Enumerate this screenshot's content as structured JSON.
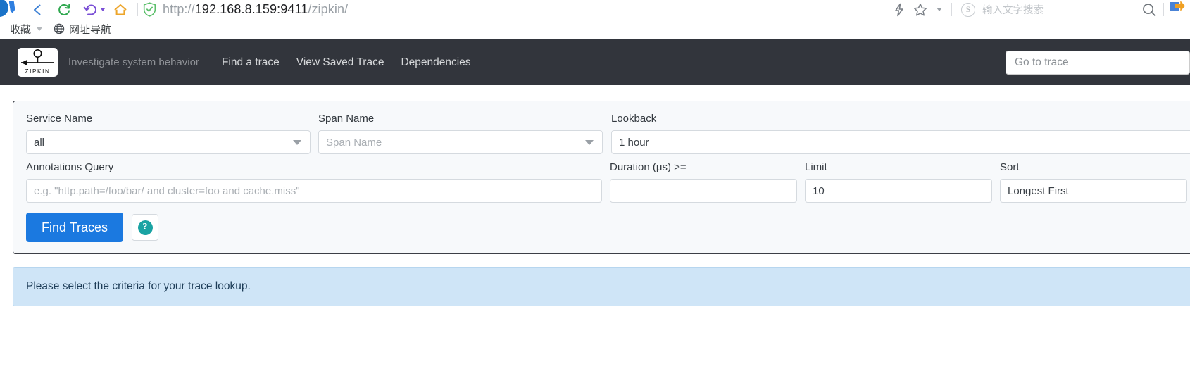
{
  "browser": {
    "back_icon": "back-arrow-icon",
    "reload_icon": "reload-icon",
    "history_icon": "undo-history-icon",
    "home_icon": "home-icon",
    "shield_icon": "security-shield-icon",
    "url_scheme": "http://",
    "url_host": "192.168.8.159:9411",
    "url_path": "/zipkin/",
    "url_full": "http://192.168.8.159:9411/zipkin/",
    "lightning_icon": "lightning-bolt-icon",
    "star_icon": "bookmark-star-icon",
    "search_engine_badge": "S",
    "search_placeholder": "输入文字搜索",
    "search_icon": "magnifier-icon",
    "extension_icon": "extension-icon",
    "bookmarks": {
      "favorites_label": "收藏",
      "nav_site_label": "网址导航",
      "globe_icon": "globe-icon"
    }
  },
  "navbar": {
    "logo_alt": "zipkin-logo",
    "logo_text": "ZIPKIN",
    "tagline": "Investigate system behavior",
    "links": [
      {
        "label": "Find a trace"
      },
      {
        "label": "View Saved Trace"
      },
      {
        "label": "Dependencies"
      }
    ],
    "goto_trace_placeholder": "Go to trace"
  },
  "search_form": {
    "service_name": {
      "label": "Service Name",
      "value": "all"
    },
    "span_name": {
      "label": "Span Name",
      "placeholder": "Span Name"
    },
    "lookback": {
      "label": "Lookback",
      "value": "1 hour"
    },
    "annotations_query": {
      "label": "Annotations Query",
      "placeholder": "e.g. \"http.path=/foo/bar/ and cluster=foo and cache.miss\""
    },
    "duration": {
      "label": "Duration (μs) >=",
      "value": ""
    },
    "limit": {
      "label": "Limit",
      "value": "10"
    },
    "sort": {
      "label": "Sort",
      "value": "Longest First"
    },
    "find_traces_label": "Find Traces",
    "help_label": "?"
  },
  "alert": {
    "message": "Please select the criteria for your trace lookup."
  },
  "colors": {
    "navbar_bg": "#32353c",
    "primary_button": "#1b79e0",
    "alert_bg": "#cfe5f7",
    "help_icon": "#1aa3a3"
  }
}
